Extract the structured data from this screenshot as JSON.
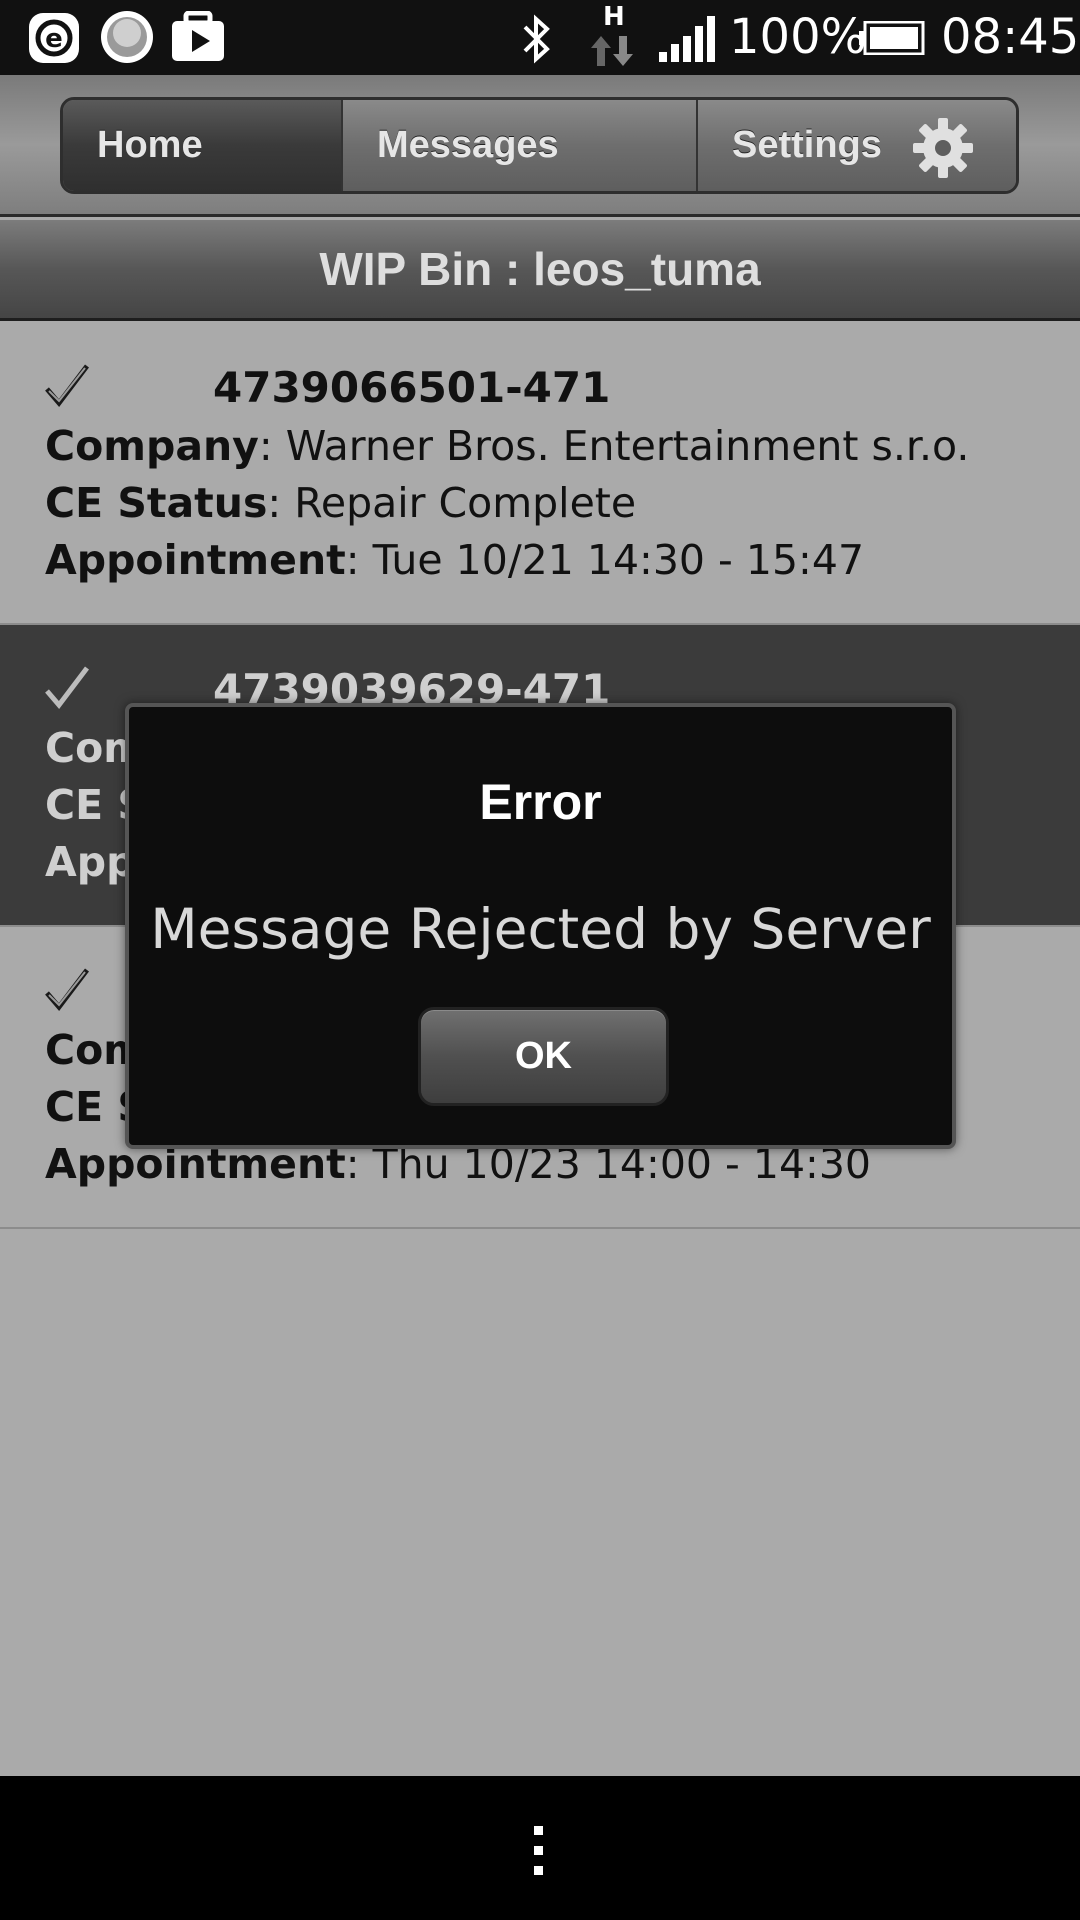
{
  "status_bar": {
    "battery": "100%",
    "time": "08:45",
    "network_indicator": "H",
    "icons": [
      "e-browser-icon",
      "circle-app-icon",
      "play-store-icon",
      "bluetooth-icon",
      "data-transfer-icon",
      "signal-icon",
      "battery-icon"
    ]
  },
  "nav": {
    "tabs": [
      {
        "label": "Home"
      },
      {
        "label": "Messages"
      },
      {
        "label": "Settings"
      }
    ],
    "settings_icon": "gear-icon"
  },
  "header": {
    "title": "WIP Bin : leos_tuma"
  },
  "list": {
    "items": [
      {
        "ticket": "4739066501-471",
        "company_label": "Company",
        "company": ": Warner Bros. Entertainment s.r.o.",
        "status_label": "CE Status",
        "status": ":  Repair Complete",
        "appt_label": "Appointment",
        "appointment": ": Tue 10/21 14:30 -  15:47"
      },
      {
        "ticket": "4739039629-471",
        "company_label": "Com",
        "status_label": "CE S",
        "appt_label": "App"
      },
      {
        "company_label": "Com",
        "status_label": "CE S",
        "appt_label": "Appointment",
        "appointment": ": Thu 10/23 14:00 -  14:30"
      }
    ]
  },
  "dialog": {
    "title": "Error",
    "message": "Message Rejected by Server",
    "ok_label": "OK"
  },
  "bottom_bar": {
    "menu_icon": "overflow-menu-icon"
  },
  "colors": {
    "background": "#aaaaaa",
    "dialog_bg": "#0d0d0d",
    "selected_row": "#3b3b3b"
  }
}
